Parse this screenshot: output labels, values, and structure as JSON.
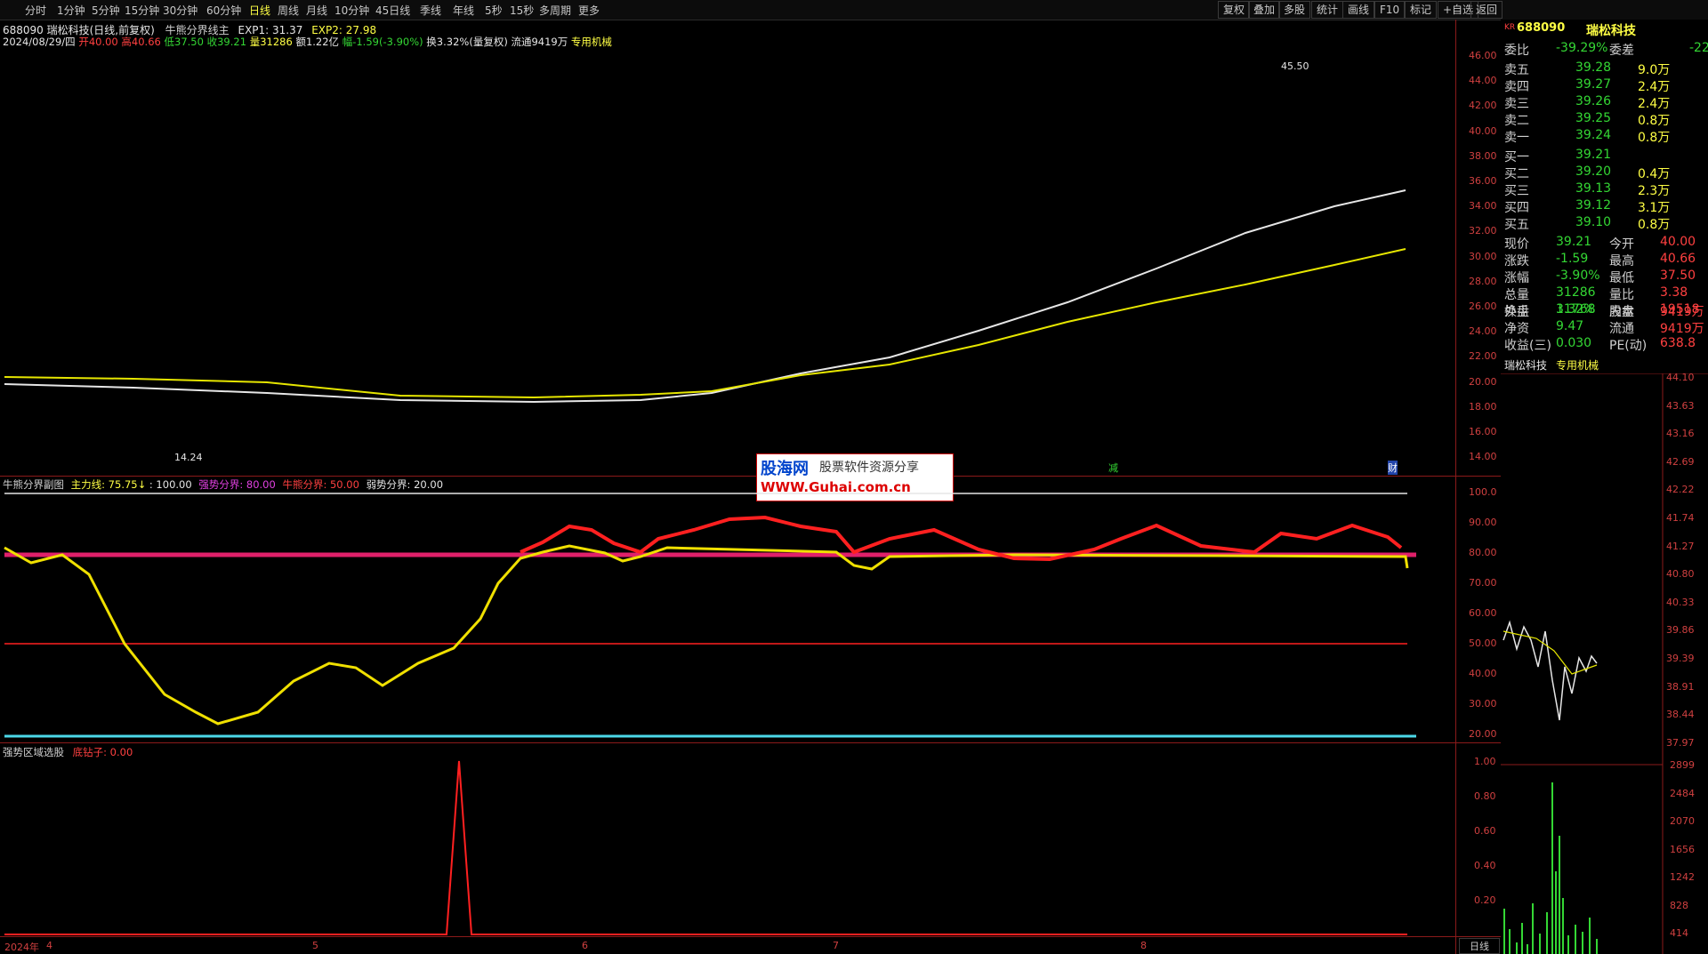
{
  "toolbar": {
    "periods": [
      "分时",
      "1分钟",
      "5分钟",
      "15分钟",
      "30分钟",
      "60分钟",
      "日线",
      "周线",
      "月线",
      "10分钟",
      "45日线",
      "季线",
      "年线",
      "5秒",
      "15秒",
      "多周期",
      "更多"
    ],
    "active": "日线",
    "buttons": [
      "复权",
      "叠加",
      "多股",
      "统计",
      "画线",
      "F10",
      "标记",
      "+自选",
      "返回"
    ]
  },
  "main": {
    "title_code": "688090 瑞松科技(日线,前复权)",
    "indicator": "牛熊分界线主",
    "exp1": "EXP1: 31.37",
    "exp2": "EXP2: 27.98",
    "date": "2024/08/29/四",
    "open": "开40.00",
    "high": "高40.66",
    "low": "低37.50",
    "close": "收39.21",
    "vol": "量31286",
    "amt": "额1.22亿",
    "chg": "幅-1.59(-3.90%)",
    "turnover": "换3.32%(量复权)",
    "float": "流通9419万",
    "sector": "专用机械",
    "high_mark": "45.50",
    "low_mark": "14.24",
    "marker_jian": "减",
    "marker_cai": "财",
    "yticks": [
      "46.00",
      "44.00",
      "42.00",
      "40.00",
      "38.00",
      "36.00",
      "34.00",
      "32.00",
      "30.00",
      "28.00",
      "26.00",
      "24.00",
      "22.00",
      "20.00",
      "18.00",
      "16.00",
      "14.00"
    ]
  },
  "sub1": {
    "title": "牛熊分界副图",
    "main_line": "主力线: 75.75↓",
    "val100": ": 100.00",
    "strong": "强势分界: 80.00",
    "bullbear": "牛熊分界: 50.00",
    "weak": "弱势分界: 20.00",
    "yticks": [
      "100.0",
      "90.00",
      "80.00",
      "70.00",
      "60.00",
      "50.00",
      "40.00",
      "30.00",
      "20.00"
    ]
  },
  "sub2": {
    "title": "强势区域选股",
    "signal": "底钻子: 0.00",
    "yticks": [
      "1.00",
      "0.80",
      "0.60",
      "0.40",
      "0.20"
    ]
  },
  "xaxis": {
    "labels": [
      "2024年",
      "4",
      "5",
      "6",
      "7",
      "8"
    ],
    "bottom_btn": "日线"
  },
  "watermark": {
    "title": "股海网",
    "subtitle": "股票软件资源分享",
    "url": "WWW.Guhai.com.cn"
  },
  "quote": {
    "tag": "KR",
    "code": "688090",
    "name": "瑞松科技",
    "weibi_label": "委比",
    "weibi": "-39.29%",
    "weicha_label": "委差",
    "weicha": "-22",
    "asks": [
      {
        "label": "卖五",
        "price": "39.28",
        "vol": "9.0万"
      },
      {
        "label": "卖四",
        "price": "39.27",
        "vol": "2.4万"
      },
      {
        "label": "卖三",
        "price": "39.26",
        "vol": "2.4万"
      },
      {
        "label": "卖二",
        "price": "39.25",
        "vol": "0.8万"
      },
      {
        "label": "卖一",
        "price": "39.24",
        "vol": "0.8万"
      }
    ],
    "bids": [
      {
        "label": "买一",
        "price": "39.21",
        "vol": ""
      },
      {
        "label": "买二",
        "price": "39.20",
        "vol": "0.4万"
      },
      {
        "label": "买三",
        "price": "39.13",
        "vol": "2.3万"
      },
      {
        "label": "买四",
        "price": "39.12",
        "vol": "3.1万"
      },
      {
        "label": "买五",
        "price": "39.10",
        "vol": "0.8万"
      }
    ],
    "stats": [
      {
        "l1": "现价",
        "v1": "39.21",
        "l2": "今开",
        "v2": "40.00"
      },
      {
        "l1": "涨跌",
        "v1": "-1.59",
        "l2": "最高",
        "v2": "40.66"
      },
      {
        "l1": "涨幅",
        "v1": "-3.90%",
        "l2": "最低",
        "v2": "37.50"
      },
      {
        "l1": "总量",
        "v1": "31286",
        "l2": "量比",
        "v2": "3.38"
      },
      {
        "l1": "外盘",
        "v1": "11768",
        "l2": "内盘",
        "v2": "19518"
      }
    ],
    "stats2": [
      {
        "l1": "换手",
        "v1": "3.32%",
        "l2": "股本",
        "v2": "9419万"
      },
      {
        "l1": "净资",
        "v1": "9.47",
        "l2": "流通",
        "v2": "9419万"
      },
      {
        "l1": "收益(三)",
        "v1": "0.030",
        "l2": "PE(动)",
        "v2": "638.8"
      }
    ],
    "mini_name": "瑞松科技",
    "mini_sector": "专用机械",
    "mini_yticks": [
      "44.10",
      "43.63",
      "43.16",
      "42.69",
      "42.22",
      "41.74",
      "41.27",
      "40.80",
      "40.33",
      "39.86",
      "39.39",
      "38.91",
      "38.44",
      "37.97"
    ],
    "vol_yticks": [
      "2899",
      "2484",
      "2070",
      "1656",
      "1242",
      "828",
      "414"
    ]
  }
}
